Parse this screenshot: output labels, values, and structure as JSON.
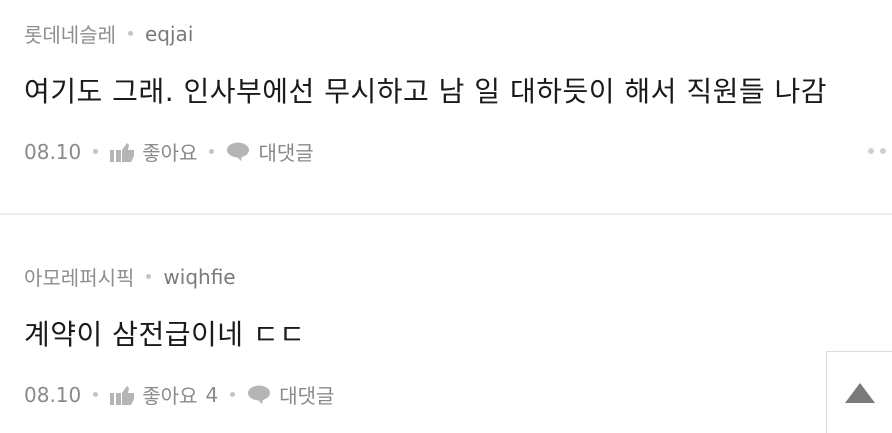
{
  "comments": [
    {
      "company": "롯데네슬레",
      "nickname": "eqjai",
      "text": "여기도 그래. 인사부에선 무시하고 남 일 대하듯이 해서 직원들 나감",
      "date": "08.10",
      "like_label": "좋아요",
      "like_count": "",
      "reply_label": "대댓글"
    },
    {
      "company": "아모레퍼시픽",
      "nickname": "wiqhfie",
      "text": "계약이 삼전급이네 ㄷㄷ",
      "date": "08.10",
      "like_label": "좋아요",
      "like_count": "4",
      "reply_label": "대댓글"
    }
  ],
  "icons": {
    "like": "thumbs-up-icon",
    "reply": "speech-bubble-icon",
    "more": "more-dots-icon",
    "scroll_top": "triangle-up-icon"
  },
  "colors": {
    "meta_text": "#8a8a8a",
    "icon": "#b5b5b5",
    "divider": "#ececec",
    "body_text": "#1a1a1a"
  }
}
